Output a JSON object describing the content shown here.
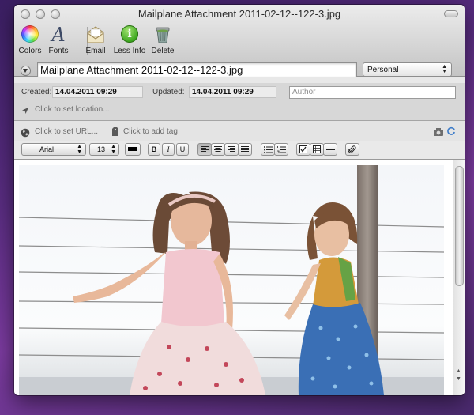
{
  "window": {
    "title": "Mailplane Attachment 2011-02-12--122-3.jpg"
  },
  "toolbar": {
    "colors_label": "Colors",
    "fonts_label": "Fonts",
    "email_label": "Email",
    "less_info_label": "Less Info",
    "delete_label": "Delete"
  },
  "note": {
    "title": "Mailplane Attachment 2011-02-12--122-3.jpg",
    "notebook": "Personal"
  },
  "meta": {
    "created_label": "Created:",
    "created_value": "14.04.2011 09:29",
    "updated_label": "Updated:",
    "updated_value": "14.04.2011 09:29",
    "author_placeholder": "Author",
    "location_prompt": "Click to set location..."
  },
  "urlbar": {
    "url_prompt": "Click to set URL...",
    "tag_prompt": "Click to add tag"
  },
  "format": {
    "font": "Arial",
    "size": "13",
    "bold": "B",
    "italic": "I",
    "underline": "U"
  },
  "icons": {
    "colors": "color-wheel-icon",
    "fonts": "font-a-icon",
    "email": "envelope-icon",
    "less_info": "info-icon",
    "delete": "trash-icon",
    "location": "location-arrow-icon",
    "url": "globe-icon",
    "tag": "tag-icon"
  }
}
